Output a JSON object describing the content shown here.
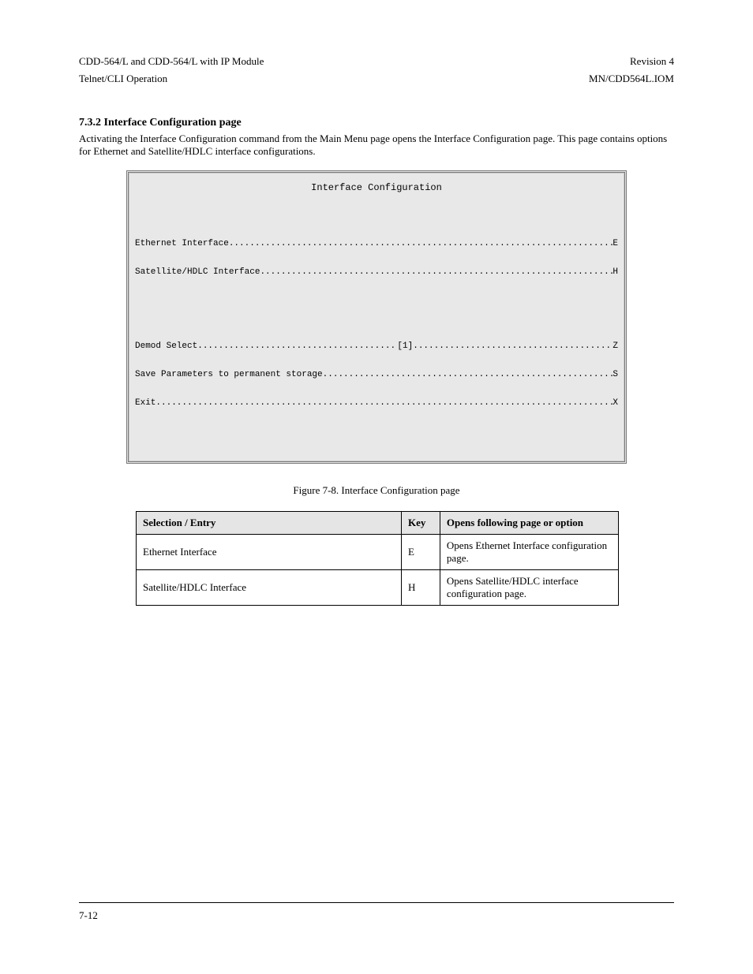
{
  "header": {
    "left_top": "CDD-564/L and CDD-564/L with IP Module",
    "right_top": "Revision 4",
    "left_sub": "Telnet/CLI Operation",
    "right_sub": "MN/CDD564L.IOM"
  },
  "section": {
    "heading": "7.3.2  Interface Configuration page",
    "body": "Activating the Interface Configuration command from the Main Menu page opens the Interface Configuration page. This page contains options for Ethernet and Satellite/HDLC interface configurations."
  },
  "console": {
    "title": "Interface Configuration",
    "block1": [
      {
        "label": "Ethernet Interface",
        "value": "",
        "key": "E"
      },
      {
        "label": "Satellite/HDLC Interface",
        "value": "",
        "key": "H"
      }
    ],
    "block2": [
      {
        "label": "Demod Select",
        "value": "[1]",
        "key": "Z"
      },
      {
        "label": "Save Parameters to permanent storage",
        "value": "",
        "key": "S"
      },
      {
        "label": "Exit",
        "value": "",
        "key": "X"
      }
    ]
  },
  "figure_caption": "Figure 7-8.  Interface Configuration page",
  "table": {
    "headers": {
      "col1": "Selection / Entry",
      "col2": "Key",
      "col3": "Opens following page or option"
    },
    "rows": [
      {
        "col1": "Ethernet Interface",
        "col2": "E",
        "col3": "Opens Ethernet Interface configuration page."
      },
      {
        "col1": "Satellite/HDLC Interface",
        "col2": "H",
        "col3": "Opens Satellite/HDLC interface configuration page."
      }
    ]
  },
  "footer": {
    "left": "7-12",
    "right": ""
  }
}
